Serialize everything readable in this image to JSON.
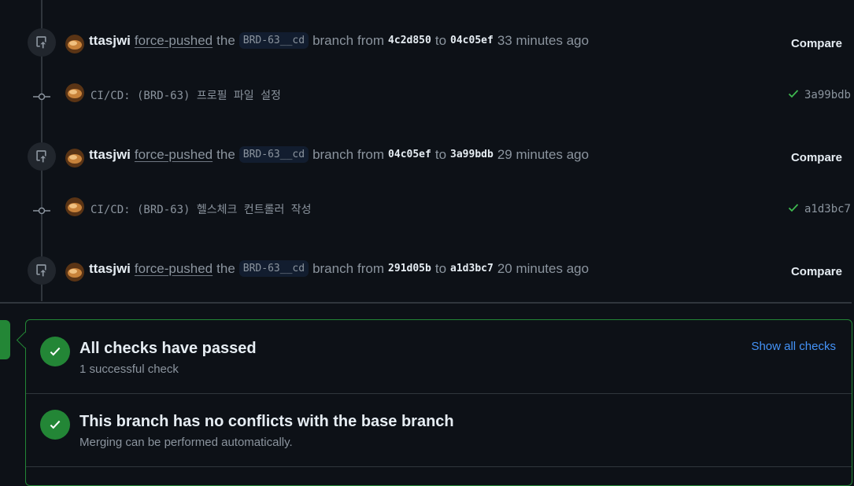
{
  "timeline": {
    "events": [
      {
        "user": "ttasjwi",
        "action": "force-pushed",
        "the": "the",
        "branch": "BRD-63__cd",
        "branch_word": "branch",
        "from_word": "from",
        "from_sha": "4c2d850",
        "to_word": "to",
        "to_sha": "04c05ef",
        "time": "33 minutes ago",
        "compare_label": "Compare"
      },
      {
        "user": "ttasjwi",
        "action": "force-pushed",
        "the": "the",
        "branch": "BRD-63__cd",
        "branch_word": "branch",
        "from_word": "from",
        "from_sha": "04c05ef",
        "to_word": "to",
        "to_sha": "3a99bdb",
        "time": "29 minutes ago",
        "compare_label": "Compare"
      },
      {
        "user": "ttasjwi",
        "action": "force-pushed",
        "the": "the",
        "branch": "BRD-63__cd",
        "branch_word": "branch",
        "from_word": "from",
        "from_sha": "291d05b",
        "to_word": "to",
        "to_sha": "a1d3bc7",
        "time": "20 minutes ago",
        "compare_label": "Compare"
      }
    ],
    "commits": [
      {
        "message": "CI/CD: (BRD-63) 프로필 파일 설정",
        "sha": "3a99bdb",
        "status": "success"
      },
      {
        "message": "CI/CD: (BRD-63) 헬스체크 컨트롤러 작성",
        "sha": "a1d3bc7",
        "status": "success"
      }
    ]
  },
  "merge_box": {
    "checks": {
      "title": "All checks have passed",
      "subtitle": "1 successful check",
      "link": "Show all checks"
    },
    "conflicts": {
      "title": "This branch has no conflicts with the base branch",
      "subtitle": "Merging can be performed automatically."
    }
  },
  "colors": {
    "success": "#238636",
    "link": "#4493f8",
    "background": "#0d1117"
  }
}
